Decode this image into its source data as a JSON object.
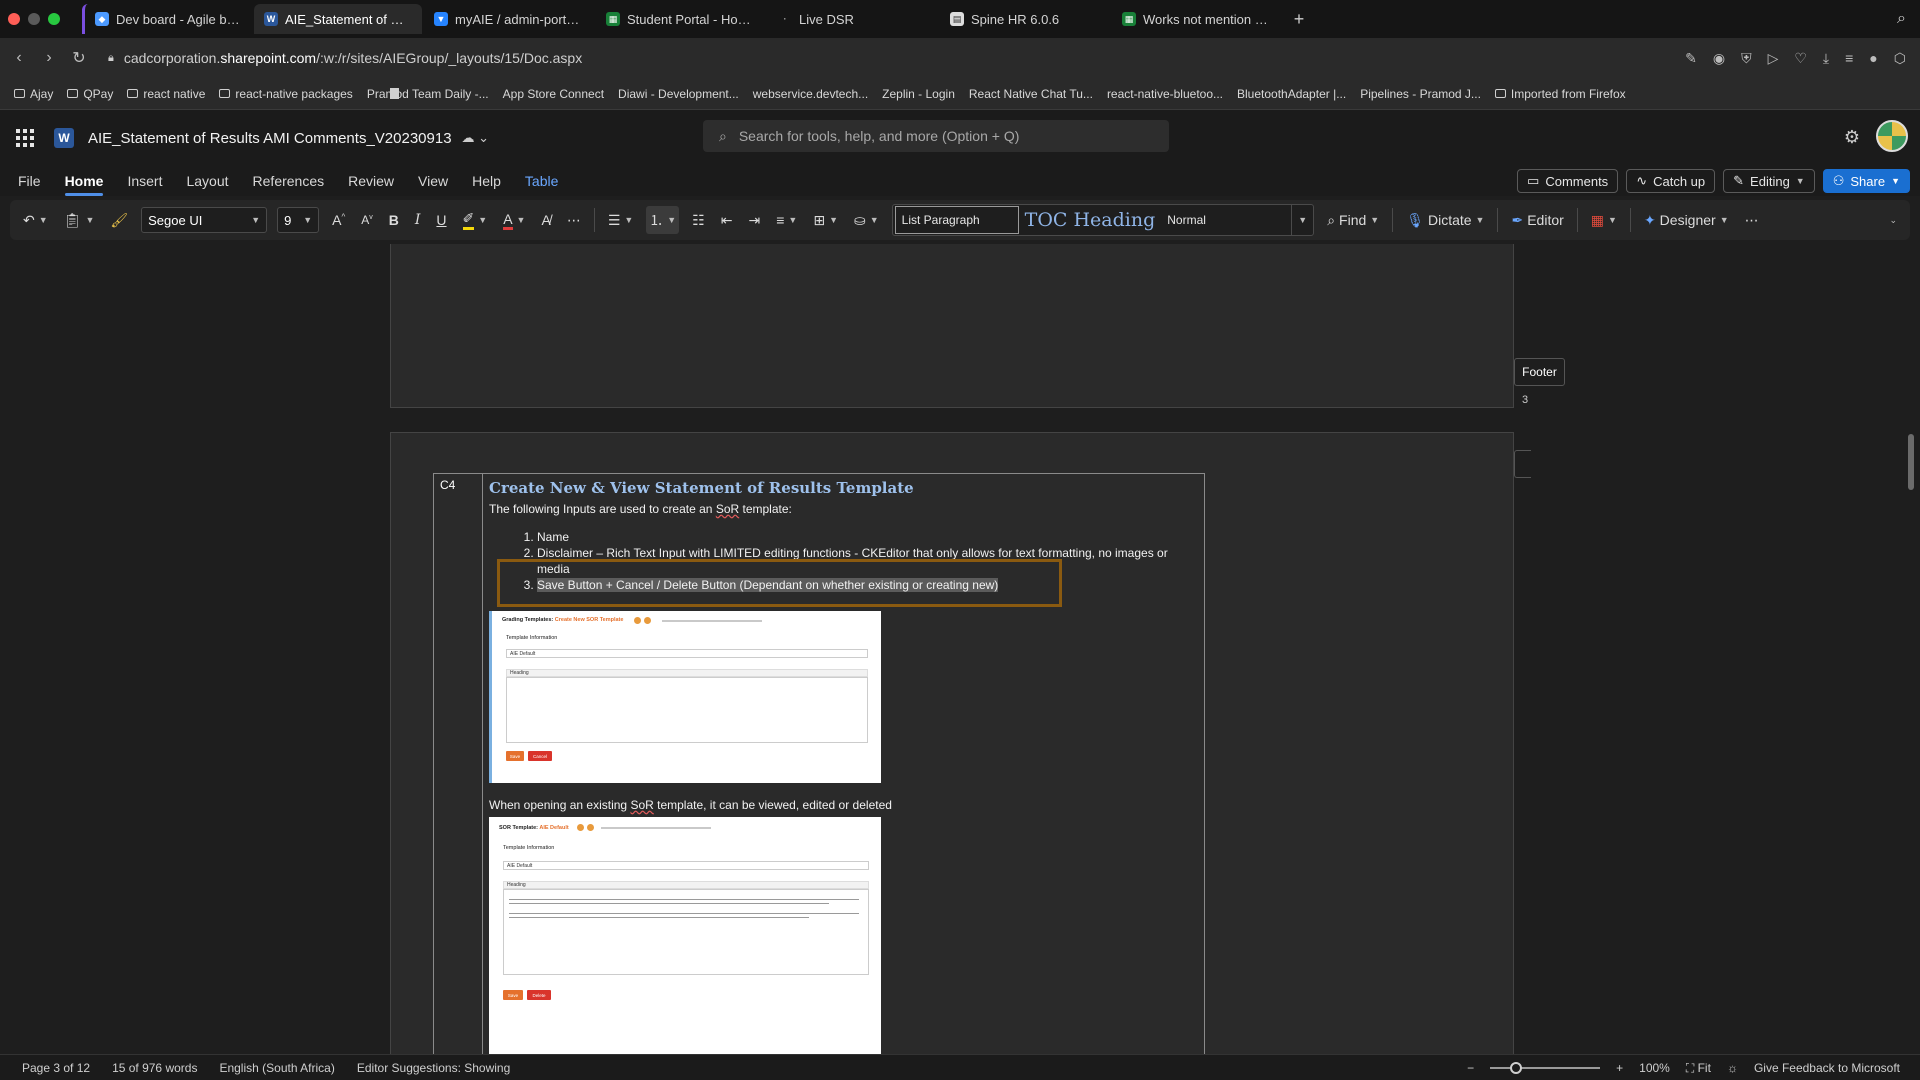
{
  "browser": {
    "tabs": [
      {
        "label": "Dev board - Agile board",
        "icon_color": "#4c9aff",
        "active": false
      },
      {
        "label": "AIE_Statement of Results",
        "icon_color": "#2b579a",
        "active": true
      },
      {
        "label": "myAIE / admin-portal / B",
        "icon_color": "#2684ff",
        "active": false
      },
      {
        "label": "Student Portal - Hourly u",
        "icon_color": "#188038",
        "active": false
      },
      {
        "label": "Live DSR",
        "icon_color": "#777777",
        "active": false
      },
      {
        "label": "Spine HR 6.0.6",
        "icon_color": "#dddddd",
        "active": false
      },
      {
        "label": "Works not mention - Goo",
        "icon_color": "#188038",
        "active": false
      }
    ],
    "url_prefix": "cadcorporation.",
    "url_host": "sharepoint.com",
    "url_path": "/:w:/r/sites/AIEGroup/_layouts/15/Doc.aspx",
    "bookmarks": [
      {
        "label": "Ajay",
        "type": "folder"
      },
      {
        "label": "QPay",
        "type": "folder"
      },
      {
        "label": "react native",
        "type": "folder"
      },
      {
        "label": "react-native packages",
        "type": "folder"
      },
      {
        "label": "Pramod Team Daily -...",
        "type": "page"
      },
      {
        "label": "App Store Connect",
        "type": "page"
      },
      {
        "label": "Diawi - Development...",
        "type": "page"
      },
      {
        "label": "webservice.devtech...",
        "type": "page"
      },
      {
        "label": "Zeplin - Login",
        "type": "page"
      },
      {
        "label": "React Native Chat Tu...",
        "type": "page"
      },
      {
        "label": "react-native-bluetoo...",
        "type": "page"
      },
      {
        "label": "BluetoothAdapter |...",
        "type": "page"
      },
      {
        "label": "Pipelines - Pramod J...",
        "type": "page"
      },
      {
        "label": "Imported from Firefox",
        "type": "folder"
      }
    ]
  },
  "word": {
    "doc_title": "AIE_Statement of Results AMI Comments_V20230913",
    "search_placeholder": "Search for tools, help, and more (Option + Q)",
    "ribbon_tabs": [
      "File",
      "Home",
      "Insert",
      "Layout",
      "References",
      "Review",
      "View",
      "Help",
      "Table"
    ],
    "active_tab": "Home",
    "actions": {
      "comments": "Comments",
      "catchup": "Catch up",
      "editing": "Editing",
      "share": "Share"
    },
    "font_name": "Segoe UI",
    "font_size": "9",
    "styles": {
      "current": "List Paragraph",
      "toc": "TOC Heading",
      "normal": "Normal"
    },
    "commands": {
      "find": "Find",
      "dictate": "Dictate",
      "editor": "Editor",
      "designer": "Designer"
    },
    "accent_color": "#4f8fe8"
  },
  "document": {
    "footer_label": "Footer",
    "page_number": "3",
    "cell_id": "C4",
    "heading": "Create New & View Statement of Results Template",
    "intro_prefix": "The following Inputs are used to create an ",
    "intro_sor": "SoR",
    "intro_suffix": " template:",
    "list": [
      "Name",
      "Disclaimer – Rich Text Input with LIMITED editing functions - CKEditor that only allows for text formatting, no images or media",
      "Save Button + Cancel / Delete Button (Dependant on whether existing or creating new)"
    ],
    "para2_prefix": "When opening an existing ",
    "para2_sor": "SoR",
    "para2_suffix": " template, it can be viewed, edited or deleted",
    "screenshot1": {
      "title": "Grading Templates:",
      "title_accent": "Create New SOR Template",
      "section": "Template Information",
      "field_value": "AIE Default",
      "toolbar": "Heading",
      "save": "Save",
      "cancel": "Cancel"
    },
    "screenshot2": {
      "title": "SOR Template:",
      "title_accent": "AIE Default",
      "section": "Template Information",
      "field_value": "AIE Default",
      "toolbar": "Heading",
      "save": "Save",
      "delete": "Delete"
    }
  },
  "status": {
    "page": "Page 3 of 12",
    "words": "15 of 976 words",
    "language": "English (South Africa)",
    "suggestions": "Editor Suggestions: Showing",
    "zoom": "100%",
    "fit": "Fit",
    "feedback": "Give Feedback to Microsoft"
  }
}
